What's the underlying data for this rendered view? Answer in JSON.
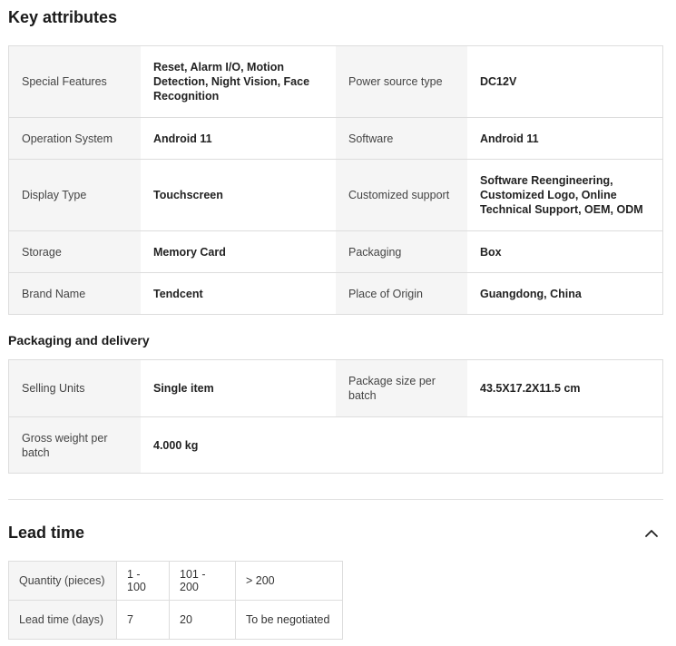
{
  "key_attributes": {
    "title": "Key attributes",
    "rows": [
      [
        {
          "label": "Special Features",
          "value": "Reset, Alarm I/O, Motion Detection, Night Vision, Face Recognition"
        },
        {
          "label": "Power source type",
          "value": "DC12V"
        }
      ],
      [
        {
          "label": "Operation System",
          "value": "Android 11"
        },
        {
          "label": "Software",
          "value": "Android 11"
        }
      ],
      [
        {
          "label": "Display Type",
          "value": "Touchscreen"
        },
        {
          "label": "Customized support",
          "value": "Software Reengineering, Customized Logo, Online Technical Support, OEM, ODM"
        }
      ],
      [
        {
          "label": "Storage",
          "value": "Memory Card"
        },
        {
          "label": "Packaging",
          "value": "Box"
        }
      ],
      [
        {
          "label": "Brand Name",
          "value": "Tendcent"
        },
        {
          "label": "Place of Origin",
          "value": "Guangdong, China"
        }
      ]
    ]
  },
  "packaging": {
    "title": "Packaging and delivery",
    "rows": [
      [
        {
          "label": "Selling Units",
          "value": "Single item"
        },
        {
          "label": "Package size per batch",
          "value": "43.5X17.2X11.5 cm"
        }
      ],
      [
        {
          "label": "Gross weight per batch",
          "value": "4.000 kg"
        }
      ]
    ]
  },
  "lead_time": {
    "title": "Lead time",
    "rows": [
      {
        "header": "Quantity (pieces)",
        "cells": [
          "1 - 100",
          "101 - 200",
          "> 200"
        ]
      },
      {
        "header": "Lead time (days)",
        "cells": [
          "7",
          "20",
          "To be negotiated"
        ]
      }
    ]
  }
}
